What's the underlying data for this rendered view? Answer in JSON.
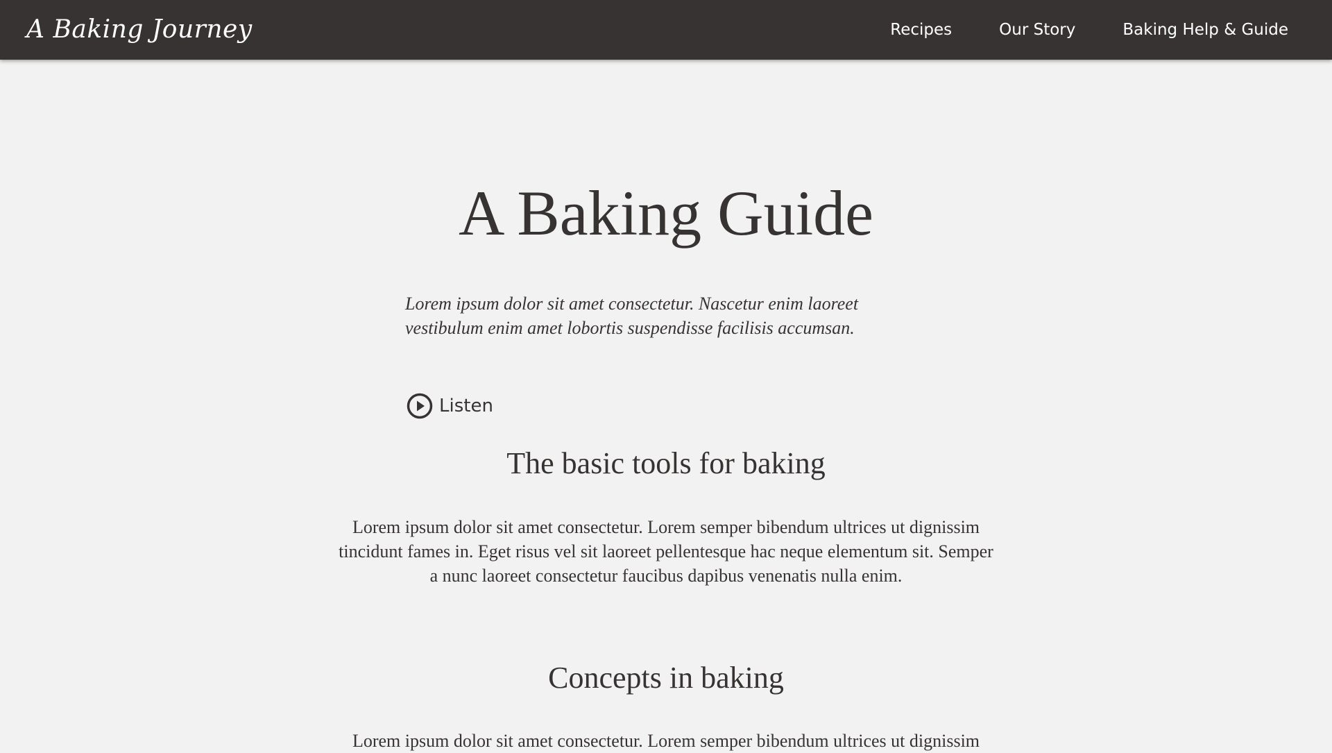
{
  "nav": {
    "logo": "A Baking Journey",
    "links": [
      "Recipes",
      "Our Story",
      "Baking Help & Guide"
    ]
  },
  "page": {
    "title": "A Baking Guide",
    "intro": "Lorem ipsum dolor sit amet consectetur. Nascetur enim laoreet vestibulum enim amet lobortis suspendisse facilisis accumsan.",
    "listen_label": "Listen",
    "listen_icon": "play-circle-icon"
  },
  "sections": [
    {
      "heading": "The basic tools for baking",
      "body": "Lorem ipsum dolor sit amet consectetur. Lorem semper bibendum ultrices ut dignissim tincidunt fames in. Eget risus vel sit laoreet pellentesque hac neque elementum sit. Semper a nunc laoreet consectetur faucibus dapibus venenatis nulla enim."
    },
    {
      "heading": "Concepts in baking",
      "body": "Lorem ipsum dolor sit amet consectetur. Lorem semper bibendum ultrices ut dignissim"
    }
  ],
  "colors": {
    "nav_background": "#373333",
    "page_background": "#f2f2f2",
    "text": "#373333"
  }
}
